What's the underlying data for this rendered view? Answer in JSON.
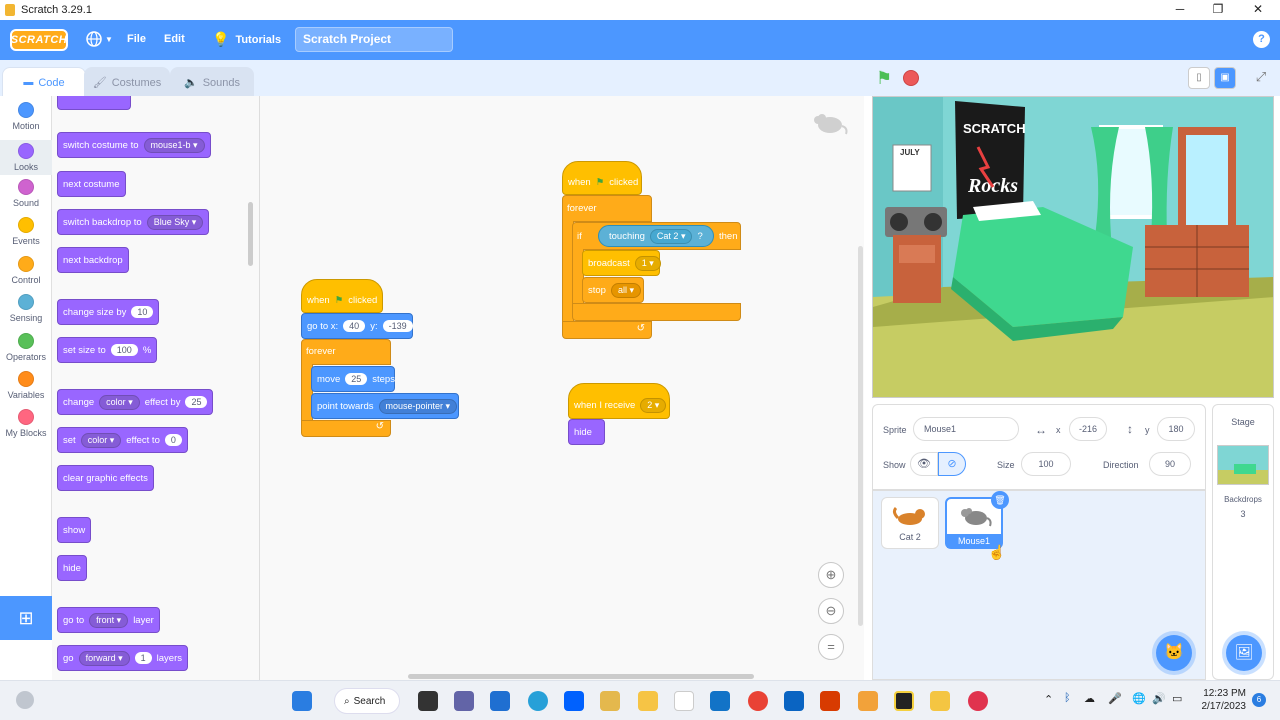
{
  "window": {
    "title": "Scratch 3.29.1",
    "minimize": "─",
    "maximize": "❐",
    "close": "✕"
  },
  "menu": {
    "logo": "SCRATCH",
    "globe_icon": "globe-icon",
    "file": "File",
    "edit": "Edit",
    "tutorials": "Tutorials",
    "project_title": "Scratch Project",
    "help": "?"
  },
  "tabs": {
    "code": "Code",
    "costumes": "Costumes",
    "sounds": "Sounds"
  },
  "categories": [
    {
      "label": "Motion",
      "color": "#4c97ff"
    },
    {
      "label": "Looks",
      "color": "#9966ff"
    },
    {
      "label": "Sound",
      "color": "#cf63cf"
    },
    {
      "label": "Events",
      "color": "#ffbf00"
    },
    {
      "label": "Control",
      "color": "#ffab19"
    },
    {
      "label": "Sensing",
      "color": "#5cb1d6"
    },
    {
      "label": "Operators",
      "color": "#59c059"
    },
    {
      "label": "Variables",
      "color": "#ff8c1a"
    },
    {
      "label": "My Blocks",
      "color": "#ff6680"
    }
  ],
  "palette": {
    "switch_costume": "switch costume to",
    "costume_value": "mouse1-b",
    "next_costume": "next costume",
    "switch_backdrop": "switch backdrop to",
    "backdrop_value": "Blue Sky",
    "next_backdrop": "next backdrop",
    "change_size": "change size by",
    "change_size_val": "10",
    "set_size": "set size to",
    "set_size_val": "100",
    "set_size_unit": "%",
    "change_effect": "change",
    "change_effect_dd": "color",
    "change_effect_mid": "effect by",
    "change_effect_val": "25",
    "set_effect": "set",
    "set_effect_dd": "color",
    "set_effect_mid": "effect to",
    "set_effect_val": "0",
    "clear_effects": "clear graphic effects",
    "show": "show",
    "hide": "hide",
    "goto_layer": "go to",
    "goto_layer_dd": "front",
    "goto_layer_end": "layer",
    "go_layers": "go",
    "go_layers_dd": "forward",
    "go_layers_val": "1",
    "go_layers_end": "layers"
  },
  "script1": {
    "when": "when",
    "clicked": "clicked",
    "goto": "go to x:",
    "x": "40",
    "y_label": "y:",
    "y": "-139",
    "forever": "forever",
    "move": "move",
    "move_val": "25",
    "steps": "steps",
    "point": "point towards",
    "point_dd": "mouse-pointer"
  },
  "script2": {
    "when": "when",
    "clicked": "clicked",
    "forever": "forever",
    "if": "if",
    "touching": "touching",
    "touching_dd": "Cat 2",
    "q": "?",
    "then": "then",
    "broadcast": "broadcast",
    "broadcast_dd": "1",
    "stop": "stop",
    "stop_dd": "all"
  },
  "script3": {
    "when_receive": "when I receive",
    "receive_dd": "2",
    "hide": "hide"
  },
  "sprite_info": {
    "sprite_label": "Sprite",
    "sprite_name": "Mouse1",
    "x_label": "x",
    "x": "-216",
    "y_label": "y",
    "y": "180",
    "show_label": "Show",
    "size_label": "Size",
    "size": "100",
    "direction_label": "Direction",
    "direction": "90"
  },
  "sprites": [
    {
      "name": "Cat 2",
      "selected": false
    },
    {
      "name": "Mouse1",
      "selected": true
    }
  ],
  "stage_pane": {
    "title": "Stage",
    "backdrops_label": "Backdrops",
    "backdrops_count": "3"
  },
  "stage_art": {
    "calendar": "JULY",
    "poster_line1": "SCRATCH",
    "poster_line2": "Rocks"
  },
  "taskbar": {
    "search": "Search",
    "time": "12:23 PM",
    "date": "2/17/2023",
    "notif": "6"
  }
}
